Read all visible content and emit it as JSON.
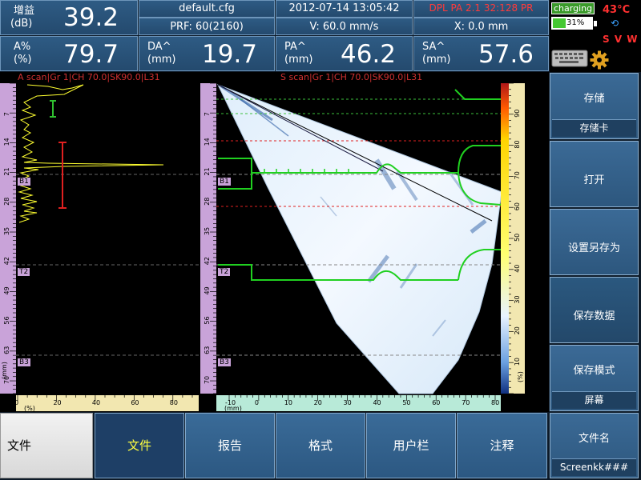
{
  "readouts": {
    "gain": {
      "label_line1": "增益",
      "label_line2": "(dB)",
      "value": "39.2"
    },
    "amp": {
      "label_line1": "A%",
      "label_line2": "(%)",
      "value": "79.7"
    },
    "da": {
      "label_line1": "DA^",
      "label_line2": "(mm)",
      "value": "19.7"
    },
    "pa": {
      "label_line1": "PA^",
      "label_line2": "(mm)",
      "value": "46.2"
    },
    "sa": {
      "label_line1": "SA^",
      "label_line2": "(mm)",
      "value": "57.6"
    }
  },
  "info": {
    "config_file": "default.cfg",
    "prf": "PRF: 60(2160)",
    "datetime": "2012-07-14 13:05:42",
    "velocity": "V: 60.0 mm/s",
    "probe": "DPL PA 2.1   32:128 PR",
    "x_pos": "X: 0.0 mm"
  },
  "status": {
    "charging": "charging",
    "battery_pct": "31%",
    "temperature": "43°C",
    "axes_label": "S V W",
    "colors": {
      "charging_bg": "#3a9a2a",
      "temp": "#ff3030",
      "battery_fill": "#45c832"
    }
  },
  "ascan": {
    "title": "A scan|Gr 1|CH 70.0|SK90.0|L31",
    "y_ticks": [
      "7",
      "14",
      "21",
      "28",
      "35",
      "42",
      "49",
      "56",
      "63",
      "70"
    ],
    "y_unit": "(mm)",
    "x_ticks": [
      "0",
      "20",
      "40",
      "60",
      "80"
    ],
    "x_unit": "(%)",
    "gates": [
      "B1",
      "T2",
      "B3"
    ],
    "cursor": "I"
  },
  "sscan": {
    "title": "S scan|Gr 1|CH 70.0|SK90.0|L31",
    "x_ticks": [
      "-10",
      "0",
      "10",
      "20",
      "30",
      "40",
      "50",
      "60",
      "70",
      "80"
    ],
    "x_unit": "(mm)",
    "gates": [
      "B1",
      "T2",
      "B3"
    ],
    "palette_ticks": [
      "90",
      "80",
      "70",
      "60",
      "50",
      "40",
      "30",
      "20",
      "10"
    ],
    "palette_unit": "(%)"
  },
  "sidebar": {
    "items": [
      {
        "label": "存储",
        "sub": "存储卡"
      },
      {
        "label": "打开",
        "sub": ""
      },
      {
        "label": "设置另存为",
        "sub": ""
      },
      {
        "label": "保存数据",
        "sub": ""
      },
      {
        "label": "保存模式",
        "sub": "屏幕"
      },
      {
        "label": "文件名",
        "sub": "Screenkk###"
      }
    ]
  },
  "menu": {
    "root": "文件",
    "tabs": [
      "文件",
      "报告",
      "格式",
      "用户栏",
      "注释"
    ]
  }
}
